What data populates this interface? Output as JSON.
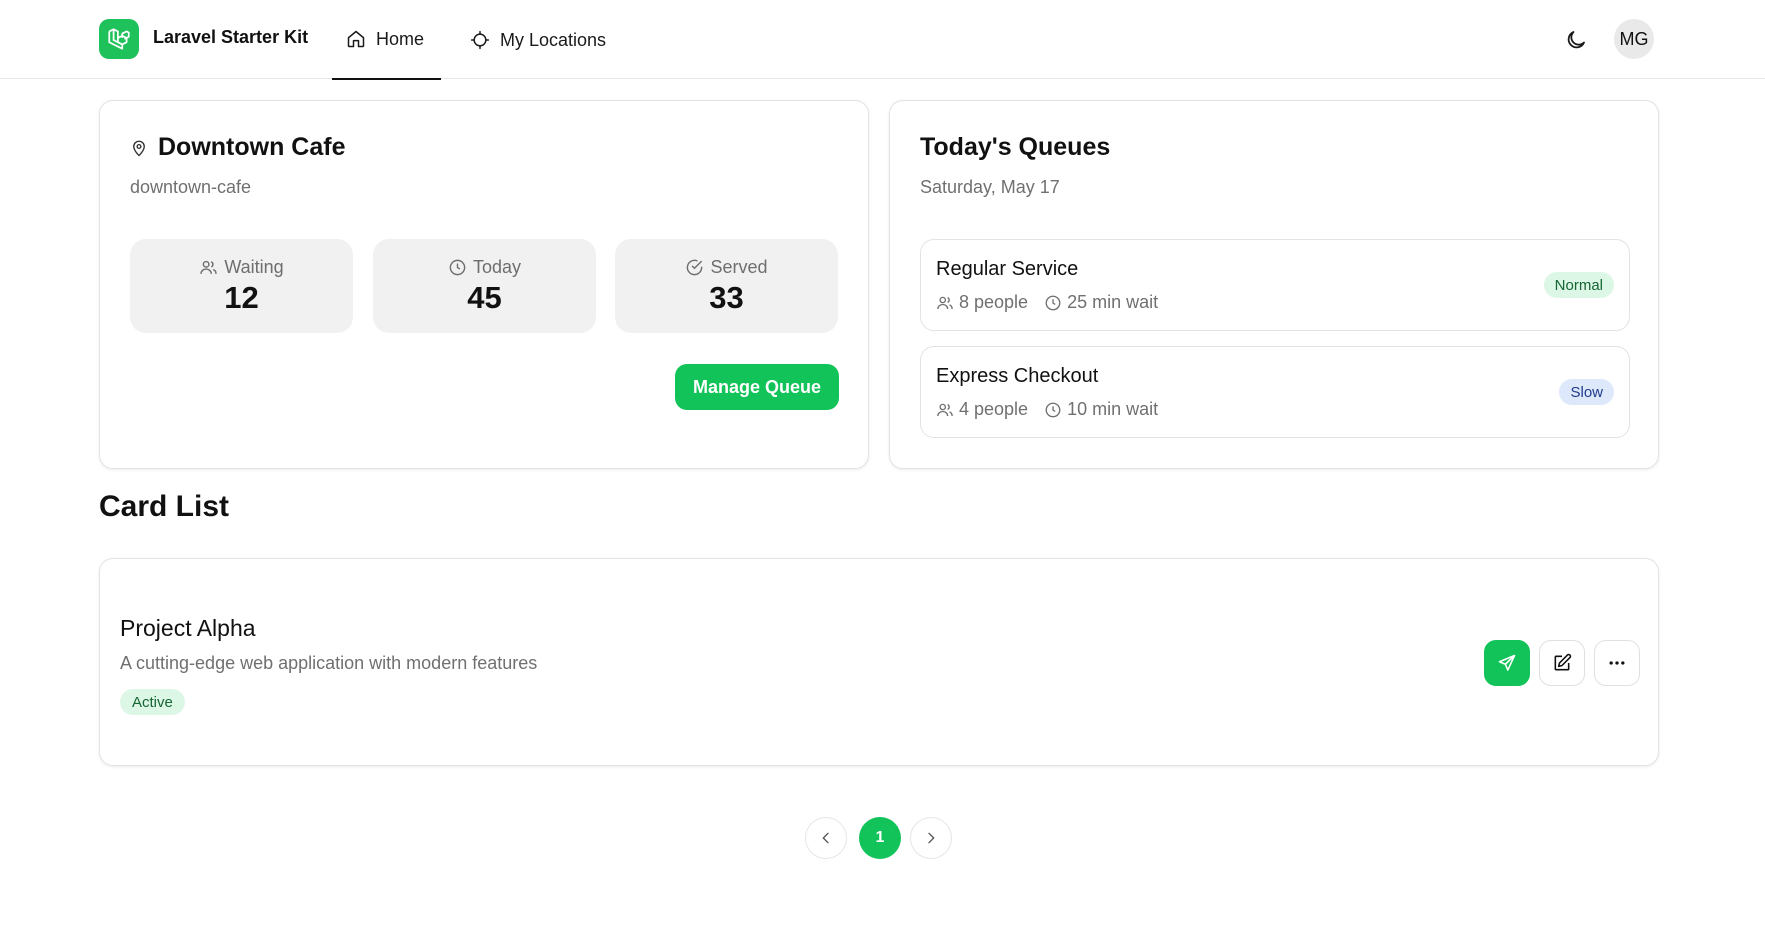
{
  "header": {
    "brand": "Laravel Starter Kit",
    "nav": [
      {
        "label": "Home",
        "icon": "home-icon",
        "active": true
      },
      {
        "label": "My Locations",
        "icon": "crosshair-icon",
        "active": false
      }
    ],
    "theme_icon": "moon-icon",
    "avatar_initials": "MG"
  },
  "location": {
    "name": "Downtown Cafe",
    "slug": "downtown-cafe",
    "stats": [
      {
        "label": "Waiting",
        "value": "12",
        "icon": "users-icon"
      },
      {
        "label": "Today",
        "value": "45",
        "icon": "clock-icon"
      },
      {
        "label": "Served",
        "value": "33",
        "icon": "check-circle-icon"
      }
    ],
    "manage_label": "Manage Queue"
  },
  "queues": {
    "title": "Today's Queues",
    "date": "Saturday, May 17",
    "items": [
      {
        "name": "Regular Service",
        "people": "8 people",
        "wait": "25 min wait",
        "status": "Normal"
      },
      {
        "name": "Express Checkout",
        "people": "4 people",
        "wait": "10 min wait",
        "status": "Slow"
      }
    ]
  },
  "card_list": {
    "title": "Card List",
    "items": [
      {
        "title": "Project Alpha",
        "description": "A cutting-edge web application with modern features",
        "status": "Active"
      }
    ]
  },
  "pagination": {
    "current": "1"
  },
  "colors": {
    "accent": "#11c358",
    "badge_green_bg": "#dcf7e5",
    "badge_blue_bg": "#dde8fb"
  }
}
